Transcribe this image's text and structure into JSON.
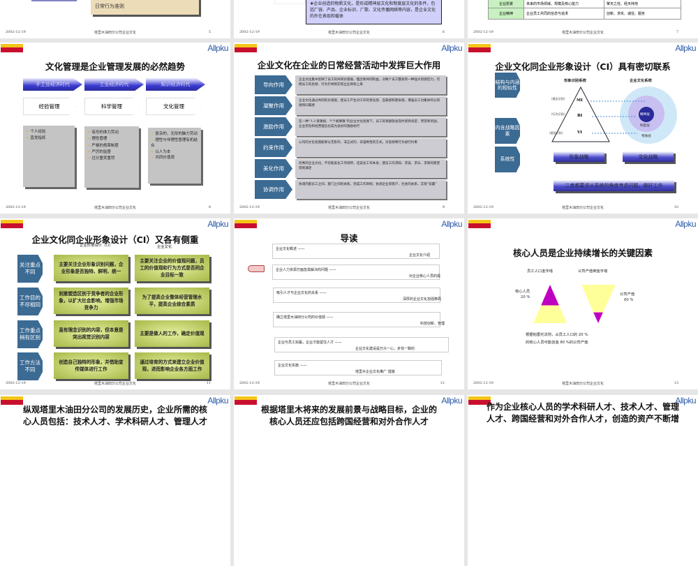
{
  "footer": {
    "date": "2002-12-19",
    "center": "塔里木油田分公司企业文化"
  },
  "logos": {
    "left": "PetroChina",
    "right": "Allpku"
  },
  "slide5": {
    "page": "5",
    "box_text": "日常行为准则"
  },
  "slide6": {
    "page": "6",
    "bullet": "❖",
    "text": "企业创造的物质文化，是形成精神层文化和制度层文化的条件，包括厂容、产品、企业标识、厂歌、文化传播网络等内容，是企业文化的外在表现和载体"
  },
  "slide7": {
    "page": "7",
    "rows": [
      {
        "name": "企业愿景",
        "desc": "未来的市场领域、规模及核心能力",
        "value": "擎天之柱、经天纬地"
      },
      {
        "name": "企业精神",
        "desc": "企业员工共同的信念与追求",
        "value": "创新、求实、诚信、服务"
      }
    ]
  },
  "slide8": {
    "page": "8",
    "title": "文化管理是企业管理发展的必然趋势",
    "eras": [
      "手工业经济时代",
      "工业经济时代",
      "知识经济时代"
    ],
    "modes": [
      "经验管理",
      "科学管理",
      "文化管理"
    ],
    "points": [
      [
        "个人经验",
        "直觉指挥"
      ],
      [
        "有形的体力劳动",
        "理性管理",
        "严格的规章制度",
        "严厉的监督",
        "过分重奖重罚"
      ],
      [
        "复杂的、无形的脑力劳动",
        "理性与非理性管理有机结合",
        "以人为本",
        "共同价值观"
      ]
    ]
  },
  "slide9": {
    "page": "9",
    "title": "企业文化在企业的日常经营活动中发挥巨大作用",
    "rows": [
      {
        "label": "导向作用",
        "text": "企业文化集中反映了员工的共同价值观、理念和共同利益，对每个员工都具有一种强大的感召力，可把员工的思想、行为引导到实现企业目标上来"
      },
      {
        "label": "凝聚作用",
        "text": "企业文化通过共同的价值观，使员工产生对工作的责任感、自豪感和使命感，增强员工对集体的认同感和归属感"
      },
      {
        "label": "激励作用",
        "text": "在一种“人人受重视、个个被尊敬”的企业文化氛围下，员工的贡献就会及时受到肯定、赞赏和奖励，企业宗旨和经营理念也成为良好的激励标尺"
      },
      {
        "label": "约束作用",
        "text": "公司的文化氛围能够以无形的、非正式的、非强制性的方式，对思想和行为进行约束"
      },
      {
        "label": "美化作用",
        "text": "优秀的企业文化，不仅能美化工作场所，还美化工作本身，使员工的求知、求美、求乐、求新的愿望得到满足"
      },
      {
        "label": "协调作用",
        "text": "协调内部员工之间、部门之间的关系，完成工作目标；协调企业同客户、社会的关系，实现“双赢”"
      }
    ]
  },
  "slide10": {
    "page": "10",
    "title": "企业文化同企业形象设计（CI）具有密切联系",
    "head_left": "形象识别系统",
    "head_right": "企业文化系统",
    "pyramid": [
      {
        "abbr": "MI",
        "name": "（理念识别）"
      },
      {
        "abbr": "BI",
        "name": "（行为识别）"
      },
      {
        "abbr": "VI",
        "name": "（视觉识别）"
      }
    ],
    "layers": [
      "精神层",
      "制度层",
      "物质层"
    ],
    "labels": [
      "结构与内涵的相似性",
      "内含战略因素",
      "系统性"
    ],
    "strategies": [
      "形象战略",
      "文化战略"
    ],
    "system_text": "二者都要求从系统的角度考虑问题，做好工作"
  },
  "slide11": {
    "page": "11",
    "title": "企业文化同企业形象设计（CI）又各有侧重",
    "col_left": "企业形象设计（CI）",
    "col_right": "企业文化",
    "rows": [
      {
        "label": "关注重点不同",
        "left": "主要关注企业形象识别问题，企业形象是否独特、鲜明、统一",
        "right": "主要关注企业的价值观问题，员工的价值观和行为方式是否同企业目标一致"
      },
      {
        "label": "工作目的不尽相同",
        "left": "刻意塑造区别于竞争者的企业形象，以扩大社会影响，增强市场竞争力",
        "right": "为了提高企业整体经营管理水平，提高企业综合素质"
      },
      {
        "label": "工作重点稍有区别",
        "left": "虽有理念识别的内容，但本意是突出视觉识别内容",
        "right": "主要是做人的工作，确定价值观"
      },
      {
        "label": "工作方法不同",
        "left": "创造自己独特的形象，并借助宣传媒体进行工作",
        "right": "通过培育的方式来建立企业价值观，进而影响企业各方面工作"
      }
    ]
  },
  "slide12": {
    "page": "12",
    "title": "导读",
    "items": [
      {
        "topic": "企业文化概述 ——",
        "sub": "企业文化介绍"
      },
      {
        "topic": "企业人力资源方面急需解决的问题 ——",
        "sub": "对企业核心人员的需"
      },
      {
        "topic": "吸引人才与企业文化的关系 ——",
        "sub": "深厚的企业文化加强移局"
      },
      {
        "topic": "确立塔里木油田分公司的价值观 ——",
        "sub": "科技创新、管理"
      },
      {
        "topic": "企业与员工双赢，企业才能留住人才 ——",
        "sub": "企业文化建设是万众一心，步伐一致的"
      },
      {
        "topic": "企业文化实施 ——",
        "sub": "塔里木企业文化推广 措施"
      }
    ]
  },
  "slide13": {
    "page": "13",
    "title": "核心人员是企业持续增长的关键因素",
    "left_head": "员工人口金字塔",
    "right_head": "公司产值倒金字塔",
    "left_label": "核心人员",
    "left_value": "20 %",
    "right_label": "公司产值",
    "right_value": "80 %",
    "note1": "根据帕雷托法则，占员工人口的 20 %",
    "note2": "的核心人员可能创造 80 %的公司产值",
    "core_share": 20,
    "output_share": 80
  },
  "slide14": {
    "title1": "纵观塔里木油田分公司的发展历史，企业所需的核",
    "title2": "心人员包括：技术人才、学术科研人才、管理人才"
  },
  "slide15": {
    "title1": "根据塔里木将来的发展前景与战略目标，企业的",
    "title2": "核心人员还应包括跨国经营和对外合作人才"
  },
  "slide16": {
    "title1": "作为企业核心人员的学术科研人才、技术人才、管理",
    "title2": "人才、跨国经营和对外合作人才，创造的资产不断增"
  },
  "colors": {
    "blue_label": "#3b6a93",
    "green_box": "#a8b848",
    "magenta": "#c000c0",
    "yellow": "#ffff99"
  }
}
